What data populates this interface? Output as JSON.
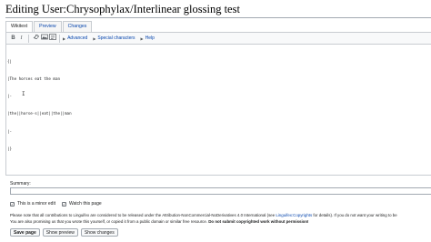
{
  "page": {
    "title": "Editing User:Chrysophylax/Interlinear glossing test"
  },
  "tabs": [
    {
      "label": "Wikitext",
      "active": true
    },
    {
      "label": "Preview"
    },
    {
      "label": "Changes"
    }
  ],
  "toolbar": {
    "bold": "B",
    "italic": "I",
    "link_icon": "link-icon",
    "media_icon": "embedded-file-icon",
    "reference_icon": "reference-icon",
    "advanced": "Advanced",
    "special_characters": "Special characters",
    "help": "Help"
  },
  "editor": {
    "lines": [
      "{|",
      "|The horses eat the man",
      "|-",
      "|the||horse-s||eat||the||man",
      "|-",
      "|}"
    ],
    "cursor": "I"
  },
  "summary": {
    "label": "Summary:",
    "value": ""
  },
  "options": {
    "minor_edit": {
      "label": "This is a minor edit",
      "checked": true
    },
    "watch": {
      "label": "Watch this page",
      "checked": true
    }
  },
  "notice": {
    "line1_a": "Please note that all contributions to Linguifex are considered to be released under the Attribution-NonCommercial-NoDerivatives 4.0 International (see ",
    "line1_link": "Linguifex:Copyrights",
    "line1_b": " for details). If you do not want your writing to be",
    "line2_a": "You are also promising us that you wrote this yourself, or copied it from a public domain or similar free resource. ",
    "line2_bold": "Do not submit copyrighted work without permission!"
  },
  "buttons": {
    "save": "Save page",
    "preview": "Show preview",
    "changes": "Show changes"
  }
}
